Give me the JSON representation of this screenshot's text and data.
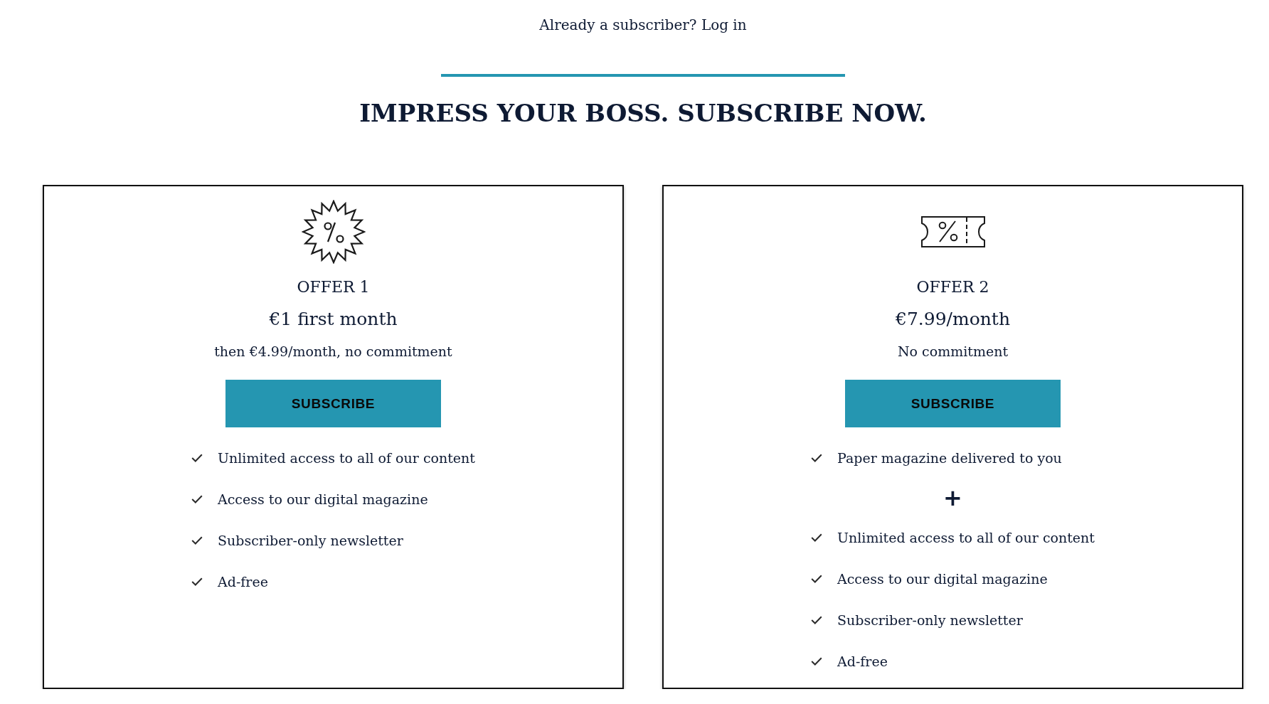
{
  "header": {
    "prompt": "Already a subscriber?",
    "link": "Log in"
  },
  "headline": "IMPRESS YOUR BOSS. SUBSCRIBE NOW.",
  "offers": [
    {
      "title": "OFFER 1",
      "price": "€1 first month",
      "terms": "then €4.99/month, no commitment",
      "button": "SUBSCRIBE",
      "features": [
        {
          "kind": "check",
          "text": "Unlimited access to all of our content"
        },
        {
          "kind": "check",
          "text": "Access to our digital magazine"
        },
        {
          "kind": "check",
          "text": "Subscriber-only newsletter"
        },
        {
          "kind": "check",
          "text": "Ad-free"
        }
      ]
    },
    {
      "title": "OFFER 2",
      "price": "€7.99/month",
      "terms": "No commitment",
      "button": "SUBSCRIBE",
      "features": [
        {
          "kind": "check",
          "text": "Paper magazine delivered to you"
        },
        {
          "kind": "plus",
          "text": "+"
        },
        {
          "kind": "check",
          "text": "Unlimited access to all of our content"
        },
        {
          "kind": "check",
          "text": "Access to our digital magazine"
        },
        {
          "kind": "check",
          "text": "Subscriber-only newsletter"
        },
        {
          "kind": "check",
          "text": "Ad-free"
        }
      ]
    }
  ]
}
